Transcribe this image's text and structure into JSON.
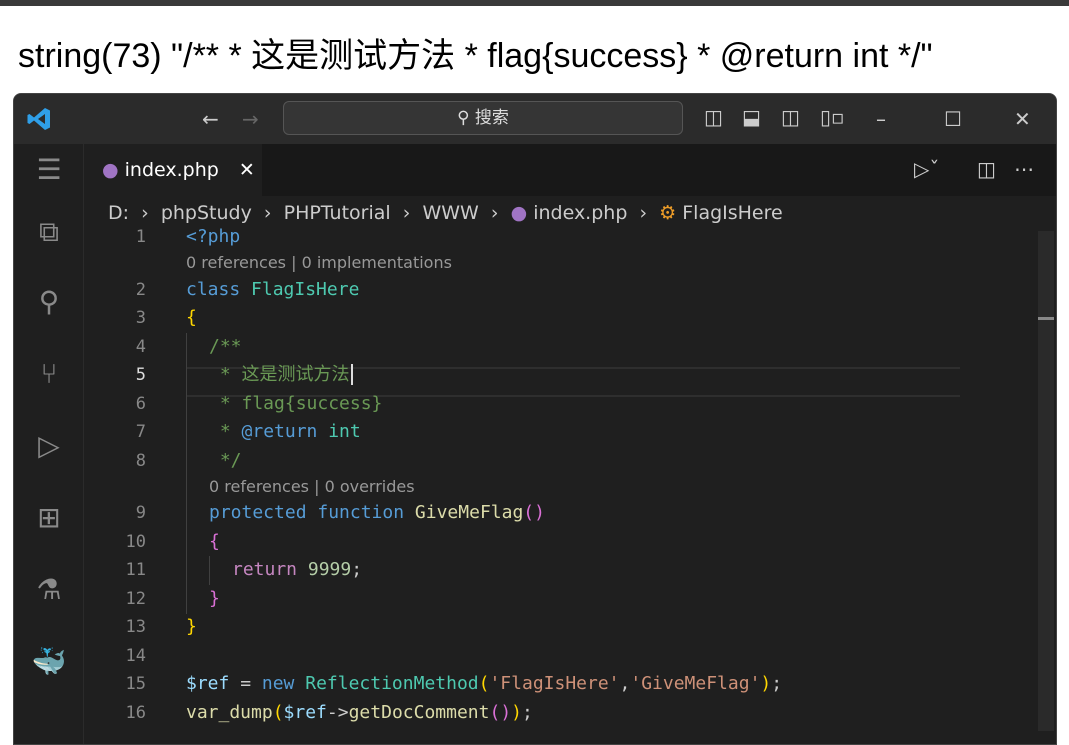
{
  "output_text": "string(73) \"/** * 这是测试方法 * flag{success} * @return int */\"",
  "titlebar": {
    "search_placeholder": "搜索",
    "search_icon": "search-icon"
  },
  "tab": {
    "label": "index.php",
    "close": "✕"
  },
  "breadcrumb": [
    "D:",
    "phpStudy",
    "PHPTutorial",
    "WWW",
    "index.php",
    "FlagIsHere"
  ],
  "colors": {
    "keyword": "#569cd6",
    "class": "#4ec9b0",
    "func": "#dcdcaa",
    "comment": "#6a9955",
    "string": "#ce9178",
    "number": "#b5cea8",
    "var": "#9cdcfe",
    "control": "#c586c0",
    "brace1": "#ffd700",
    "brace2": "#da70d6"
  },
  "lines": [
    {
      "n": "1",
      "indent": 0,
      "tokens": [
        [
          "<?php",
          "#569cd6"
        ]
      ]
    },
    {
      "lens": "0 references | 0 implementations",
      "indent": 0
    },
    {
      "n": "2",
      "indent": 0,
      "tokens": [
        [
          "class ",
          "#569cd6"
        ],
        [
          "FlagIsHere",
          "#4ec9b0"
        ]
      ]
    },
    {
      "n": "3",
      "indent": 0,
      "tokens": [
        [
          "{",
          "#ffd700"
        ]
      ]
    },
    {
      "n": "4",
      "indent": 1,
      "tokens": [
        [
          "/**",
          "#6a9955"
        ]
      ]
    },
    {
      "n": "5",
      "indent": 1,
      "cur": true,
      "tokens": [
        [
          " * 这是测试方法",
          "#6a9955"
        ]
      ]
    },
    {
      "n": "6",
      "indent": 1,
      "tokens": [
        [
          " * flag{success}",
          "#6a9955"
        ]
      ]
    },
    {
      "n": "7",
      "indent": 1,
      "tokens": [
        [
          " * ",
          "#6a9955"
        ],
        [
          "@return",
          "#569cd6"
        ],
        [
          " ",
          "#6a9955"
        ],
        [
          "int",
          "#4ec9b0"
        ]
      ]
    },
    {
      "n": "8",
      "indent": 1,
      "tokens": [
        [
          " */",
          "#6a9955"
        ]
      ]
    },
    {
      "lens": "0 references | 0 overrides",
      "indent": 1
    },
    {
      "n": "9",
      "indent": 1,
      "tokens": [
        [
          "protected ",
          "#569cd6"
        ],
        [
          "function ",
          "#569cd6"
        ],
        [
          "GiveMeFlag",
          "#dcdcaa"
        ],
        [
          "()",
          "#da70d6"
        ]
      ]
    },
    {
      "n": "10",
      "indent": 1,
      "tokens": [
        [
          "{",
          "#da70d6"
        ]
      ]
    },
    {
      "n": "11",
      "indent": 2,
      "tokens": [
        [
          "return ",
          "#c586c0"
        ],
        [
          "9999",
          "#b5cea8"
        ],
        [
          ";",
          "#cccccc"
        ]
      ]
    },
    {
      "n": "12",
      "indent": 1,
      "tokens": [
        [
          "}",
          "#da70d6"
        ]
      ]
    },
    {
      "n": "13",
      "indent": 0,
      "tokens": [
        [
          "}",
          "#ffd700"
        ]
      ]
    },
    {
      "n": "14",
      "indent": 0,
      "tokens": []
    },
    {
      "n": "15",
      "indent": 0,
      "tokens": [
        [
          "$ref",
          "#9cdcfe"
        ],
        [
          " = ",
          "#cccccc"
        ],
        [
          "new ",
          "#569cd6"
        ],
        [
          "ReflectionMethod",
          "#4ec9b0"
        ],
        [
          "(",
          "#ffd700"
        ],
        [
          "'FlagIsHere'",
          "#ce9178"
        ],
        [
          ",",
          "#cccccc"
        ],
        [
          "'GiveMeFlag'",
          "#ce9178"
        ],
        [
          ")",
          "#ffd700"
        ],
        [
          ";",
          "#cccccc"
        ]
      ]
    },
    {
      "n": "16",
      "indent": 0,
      "tokens": [
        [
          "var_dump",
          "#dcdcaa"
        ],
        [
          "(",
          "#ffd700"
        ],
        [
          "$ref",
          "#9cdcfe"
        ],
        [
          "->",
          "#cccccc"
        ],
        [
          "getDocComment",
          "#dcdcaa"
        ],
        [
          "()",
          "#da70d6"
        ],
        [
          ")",
          "#ffd700"
        ],
        [
          ";",
          "#cccccc"
        ]
      ]
    }
  ]
}
